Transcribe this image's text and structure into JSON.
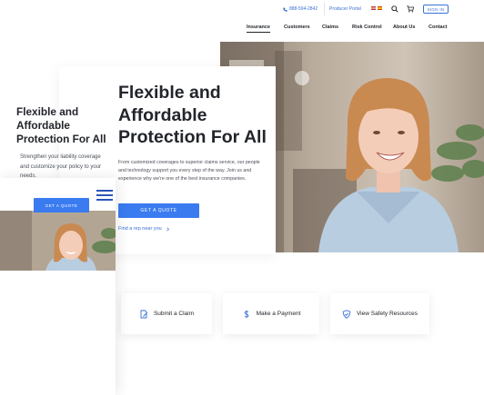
{
  "topbar": {
    "phone": "888-594-2842",
    "producer_portal": "Producer Portal",
    "flags": [
      "us-flag",
      "es-flag"
    ],
    "sign_in": "SIGN IN"
  },
  "nav": {
    "items": [
      {
        "label": "Insurance",
        "active": true
      },
      {
        "label": "Customers",
        "active": false
      },
      {
        "label": "Claims",
        "active": false
      },
      {
        "label": "Risk Control",
        "active": false
      },
      {
        "label": "About Us",
        "active": false
      },
      {
        "label": "Contact",
        "active": false
      }
    ]
  },
  "hero": {
    "title_line1": "Flexible and",
    "title_line2": "Affordable",
    "title_line3": "Protection For All",
    "body": "From customized coverages to superior claims service, our people and technology support you every step of the way. Join us and experience why we're one of the best insurance companies.",
    "cta": "GET A QUOTE",
    "find_rep": "Find a rep near you"
  },
  "actions": [
    {
      "label": "Submit a Claim",
      "icon": "document-edit-icon"
    },
    {
      "label": "Make a Payment",
      "icon": "dollar-icon"
    },
    {
      "label": "View Safety Resources",
      "icon": "shield-check-icon"
    }
  ],
  "mobile": {
    "title_line1": "Flexible and",
    "title_line2": "Affordable",
    "title_line3": "Protection For All",
    "body": "Strengthen your liability coverage and customize your policy to your needs.",
    "cta": "GET A QUOTE"
  },
  "colors": {
    "accent": "#3a7bf0",
    "link": "#3a6fd8",
    "text": "#22252b"
  }
}
